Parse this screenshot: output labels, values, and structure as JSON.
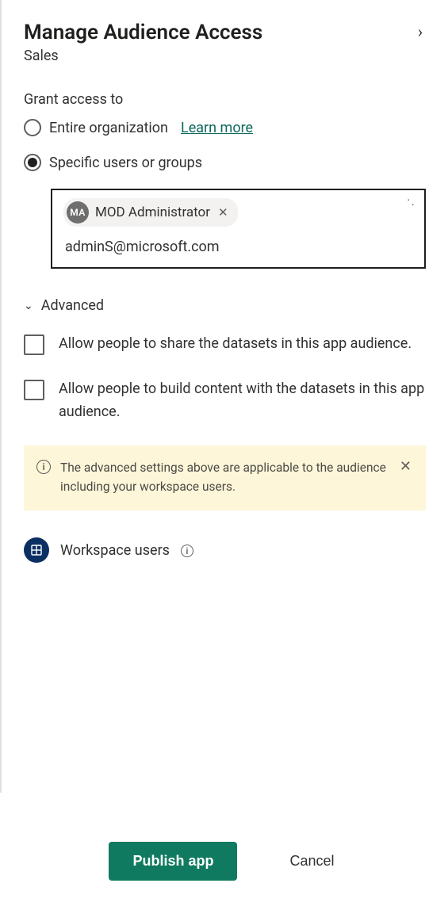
{
  "header": {
    "title": "Manage Audience Access",
    "subtitle": "Sales"
  },
  "grant": {
    "section_label": "Grant access to",
    "option_org": "Entire organization",
    "learn_more": "Learn more",
    "option_specific": "Specific users or groups",
    "selected": "specific",
    "chip": {
      "initials": "MA",
      "name": "MOD Administrator"
    },
    "input_value": "adminS@microsoft.com"
  },
  "advanced": {
    "label": "Advanced",
    "expanded": true,
    "check_share": "Allow people to share the datasets in this app audience.",
    "check_build": "Allow people to build content with the datasets in this app audience.",
    "notice": "The advanced settings above are applicable to the audience including your workspace users."
  },
  "workspace_users_label": "Workspace users",
  "footer": {
    "publish": "Publish app",
    "cancel": "Cancel"
  }
}
